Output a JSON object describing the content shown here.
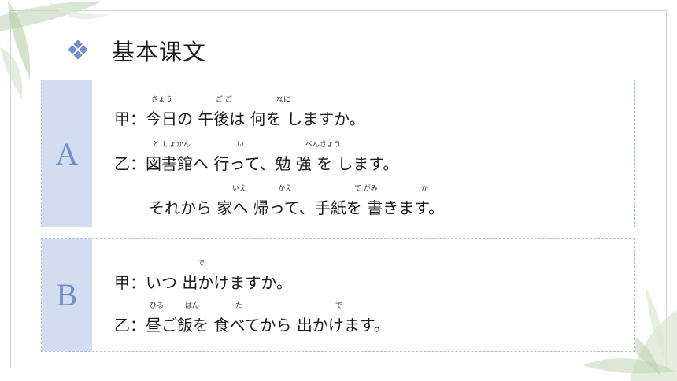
{
  "title": "基本课文",
  "sections": [
    {
      "label": "A",
      "lines": [
        {
          "text": "甲：今日の 午後は 何を しますか。",
          "ruby": [
            "きょう",
            "ご ご",
            "なに"
          ]
        },
        {
          "text": "乙：図書館へ 行って、勉 強 を します。",
          "ruby": [
            "と しょかん",
            "い",
            "べんきょう"
          ]
        },
        {
          "text": "それから 家へ 帰って、手紙を 書きます。",
          "ruby": [
            "いえ",
            "かえ",
            "て がみ",
            "か"
          ]
        }
      ]
    },
    {
      "label": "B",
      "lines": [
        {
          "text": "甲：いつ 出かけますか。",
          "ruby": [
            "で"
          ]
        },
        {
          "text": "乙：昼ご飯を 食べてから 出かけます。",
          "ruby": [
            "ひる",
            "はん",
            "た",
            "で"
          ]
        }
      ]
    }
  ],
  "icons": {
    "title_bullet": "diamond-cluster-icon",
    "leaf_top_left": "bamboo-leaf-icon",
    "leaf_bottom_right": "bamboo-leaf-icon"
  },
  "colors": {
    "accent": "#6f90c8",
    "panel_label_bg": "#d3ddef",
    "panel_border": "#a9bde0"
  }
}
